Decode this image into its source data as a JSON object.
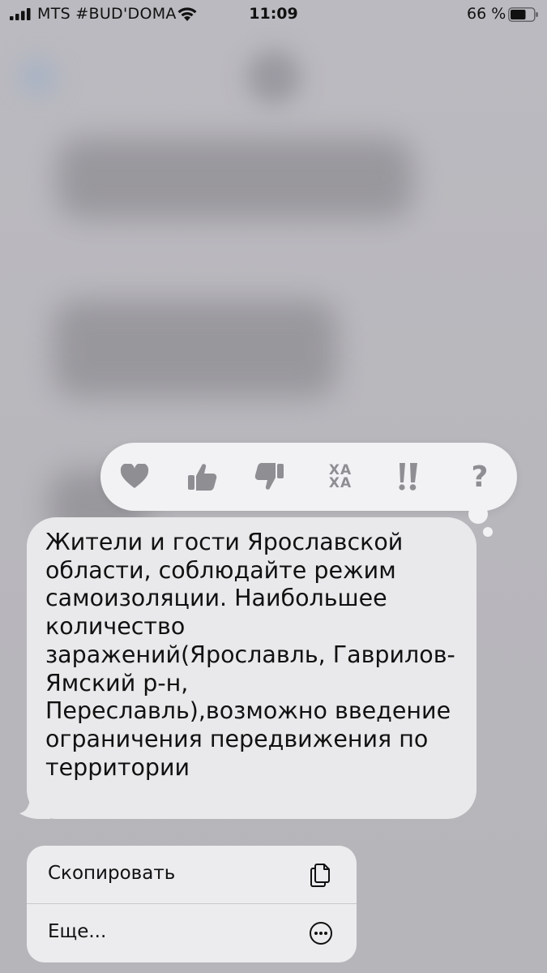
{
  "status_bar": {
    "carrier": "MTS #BUD'DOMA",
    "time": "11:09",
    "battery_percent": "66 %",
    "battery_level": 0.66,
    "icons": [
      "cell-signal-icon",
      "wifi-icon",
      "battery-icon"
    ]
  },
  "tapback": {
    "reactions": [
      {
        "name": "heart-icon"
      },
      {
        "name": "thumbs-up-icon"
      },
      {
        "name": "thumbs-down-icon"
      },
      {
        "name": "haha-icon",
        "label_top": "ХА",
        "label_bottom": "ХА"
      },
      {
        "name": "exclamation-icon",
        "label": "‼"
      },
      {
        "name": "question-icon",
        "label": "?"
      }
    ],
    "icon_color": "#8f8e93"
  },
  "message": {
    "text": "Жители и гости Ярославской\nобласти, соблюдайте режим\nсамоизоляции. Наибольшее\nколичество\nзаражений(Ярославль, Гаврилов-\nЯмский р-н,\nПереславль),возможно введение\nограничения передвижения по\nтерритории"
  },
  "context_menu": {
    "copy_label": "Скопировать",
    "more_label": "Еще..."
  },
  "colors": {
    "bubble": "#e9e9eb",
    "menu": "#ececee",
    "backdrop": "#b9b8bd"
  }
}
